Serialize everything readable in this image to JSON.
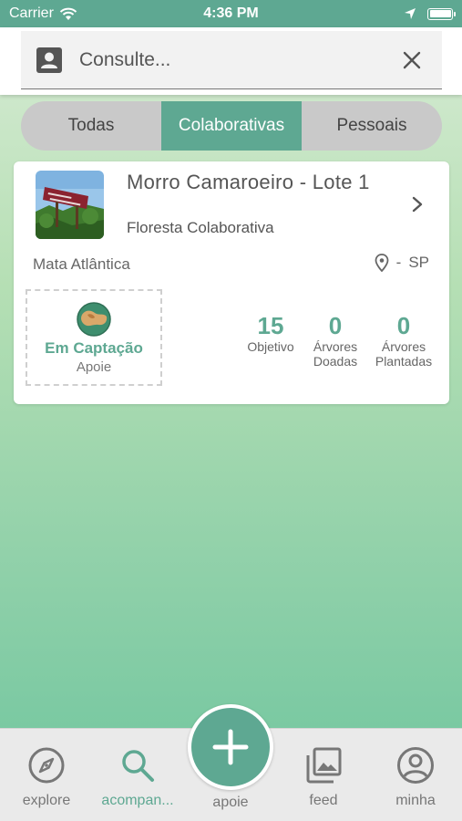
{
  "status_bar": {
    "carrier": "Carrier",
    "time": "4:36 PM"
  },
  "search": {
    "placeholder": "Consulte..."
  },
  "tabs": [
    {
      "label": "Todas",
      "active": false
    },
    {
      "label": "Colaborativas",
      "active": true
    },
    {
      "label": "Pessoais",
      "active": false
    }
  ],
  "card": {
    "title": "Morro Camaroeiro - Lote 1",
    "subtitle": "Floresta Colaborativa",
    "biome": "Mata Atlântica",
    "location_separator": "-",
    "location_state": "SP",
    "status_label": "Em Captação",
    "status_sub": "Apoie",
    "stats": [
      {
        "value": "15",
        "label": "Objetivo"
      },
      {
        "value": "0",
        "label": "Árvores Doadas"
      },
      {
        "value": "0",
        "label": "Árvores Plantadas"
      }
    ]
  },
  "nav": {
    "explore": "explore",
    "acompanhe": "acompan...",
    "apoie": "apoie",
    "feed": "feed",
    "minha": "minha"
  },
  "colors": {
    "accent": "#5ea892",
    "tab_inactive": "#c9c9c9"
  }
}
